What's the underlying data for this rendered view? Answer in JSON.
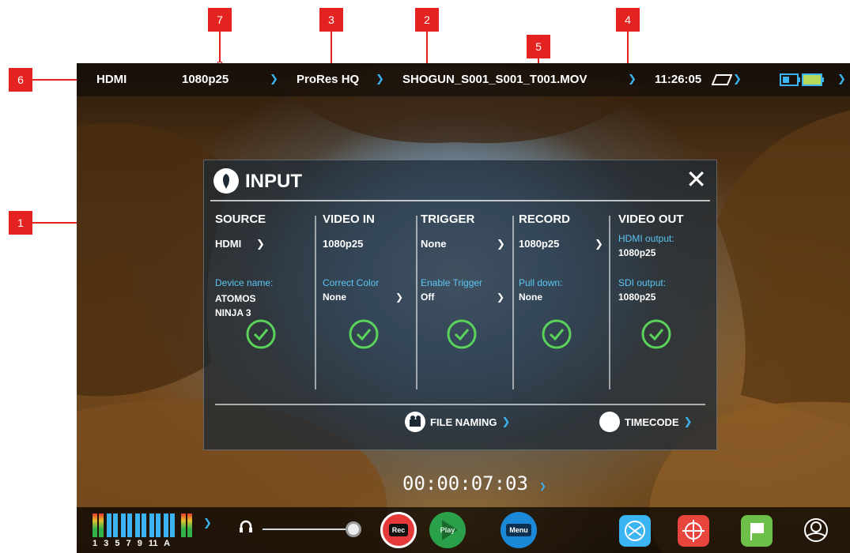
{
  "callouts": [
    "1",
    "2",
    "3",
    "4",
    "5",
    "6",
    "7"
  ],
  "topbar": {
    "source": "HDMI",
    "format": "1080p25",
    "codec": "ProRes HQ",
    "filename": "SHOGUN_S001_S001_T001.MOV",
    "time": "11:26:05"
  },
  "panel": {
    "title": "INPUT",
    "columns": [
      {
        "header": "SOURCE",
        "value": "HDMI",
        "label": "Device name:",
        "sub": "ATOMOS",
        "sub2": "NINJA 3"
      },
      {
        "header": "VIDEO IN",
        "value": "1080p25",
        "label": "Correct Color",
        "sub": "None"
      },
      {
        "header": "TRIGGER",
        "value": "None",
        "label": "Enable Trigger",
        "sub": "Off"
      },
      {
        "header": "RECORD",
        "value": "1080p25",
        "label": "Pull down:",
        "sub": "None"
      },
      {
        "header": "VIDEO OUT",
        "label": "HDMI output:",
        "value": "1080p25",
        "label2": "SDI output:",
        "sub": "1080p25"
      }
    ],
    "buttons": {
      "file_naming": "FILE NAMING",
      "timecode": "TIMECODE"
    }
  },
  "timecode": "00:00:07:03",
  "bottombar": {
    "meter_labels": "1 3 5 7 9 11 A",
    "rec_label": "Rec",
    "play_label": "Play",
    "menu_label": "Menu"
  },
  "colors": {
    "callout": "#e42321",
    "accent_blue": "#3ab4f2",
    "check_green": "#5ad35a",
    "rec_red": "#e63a3a"
  }
}
